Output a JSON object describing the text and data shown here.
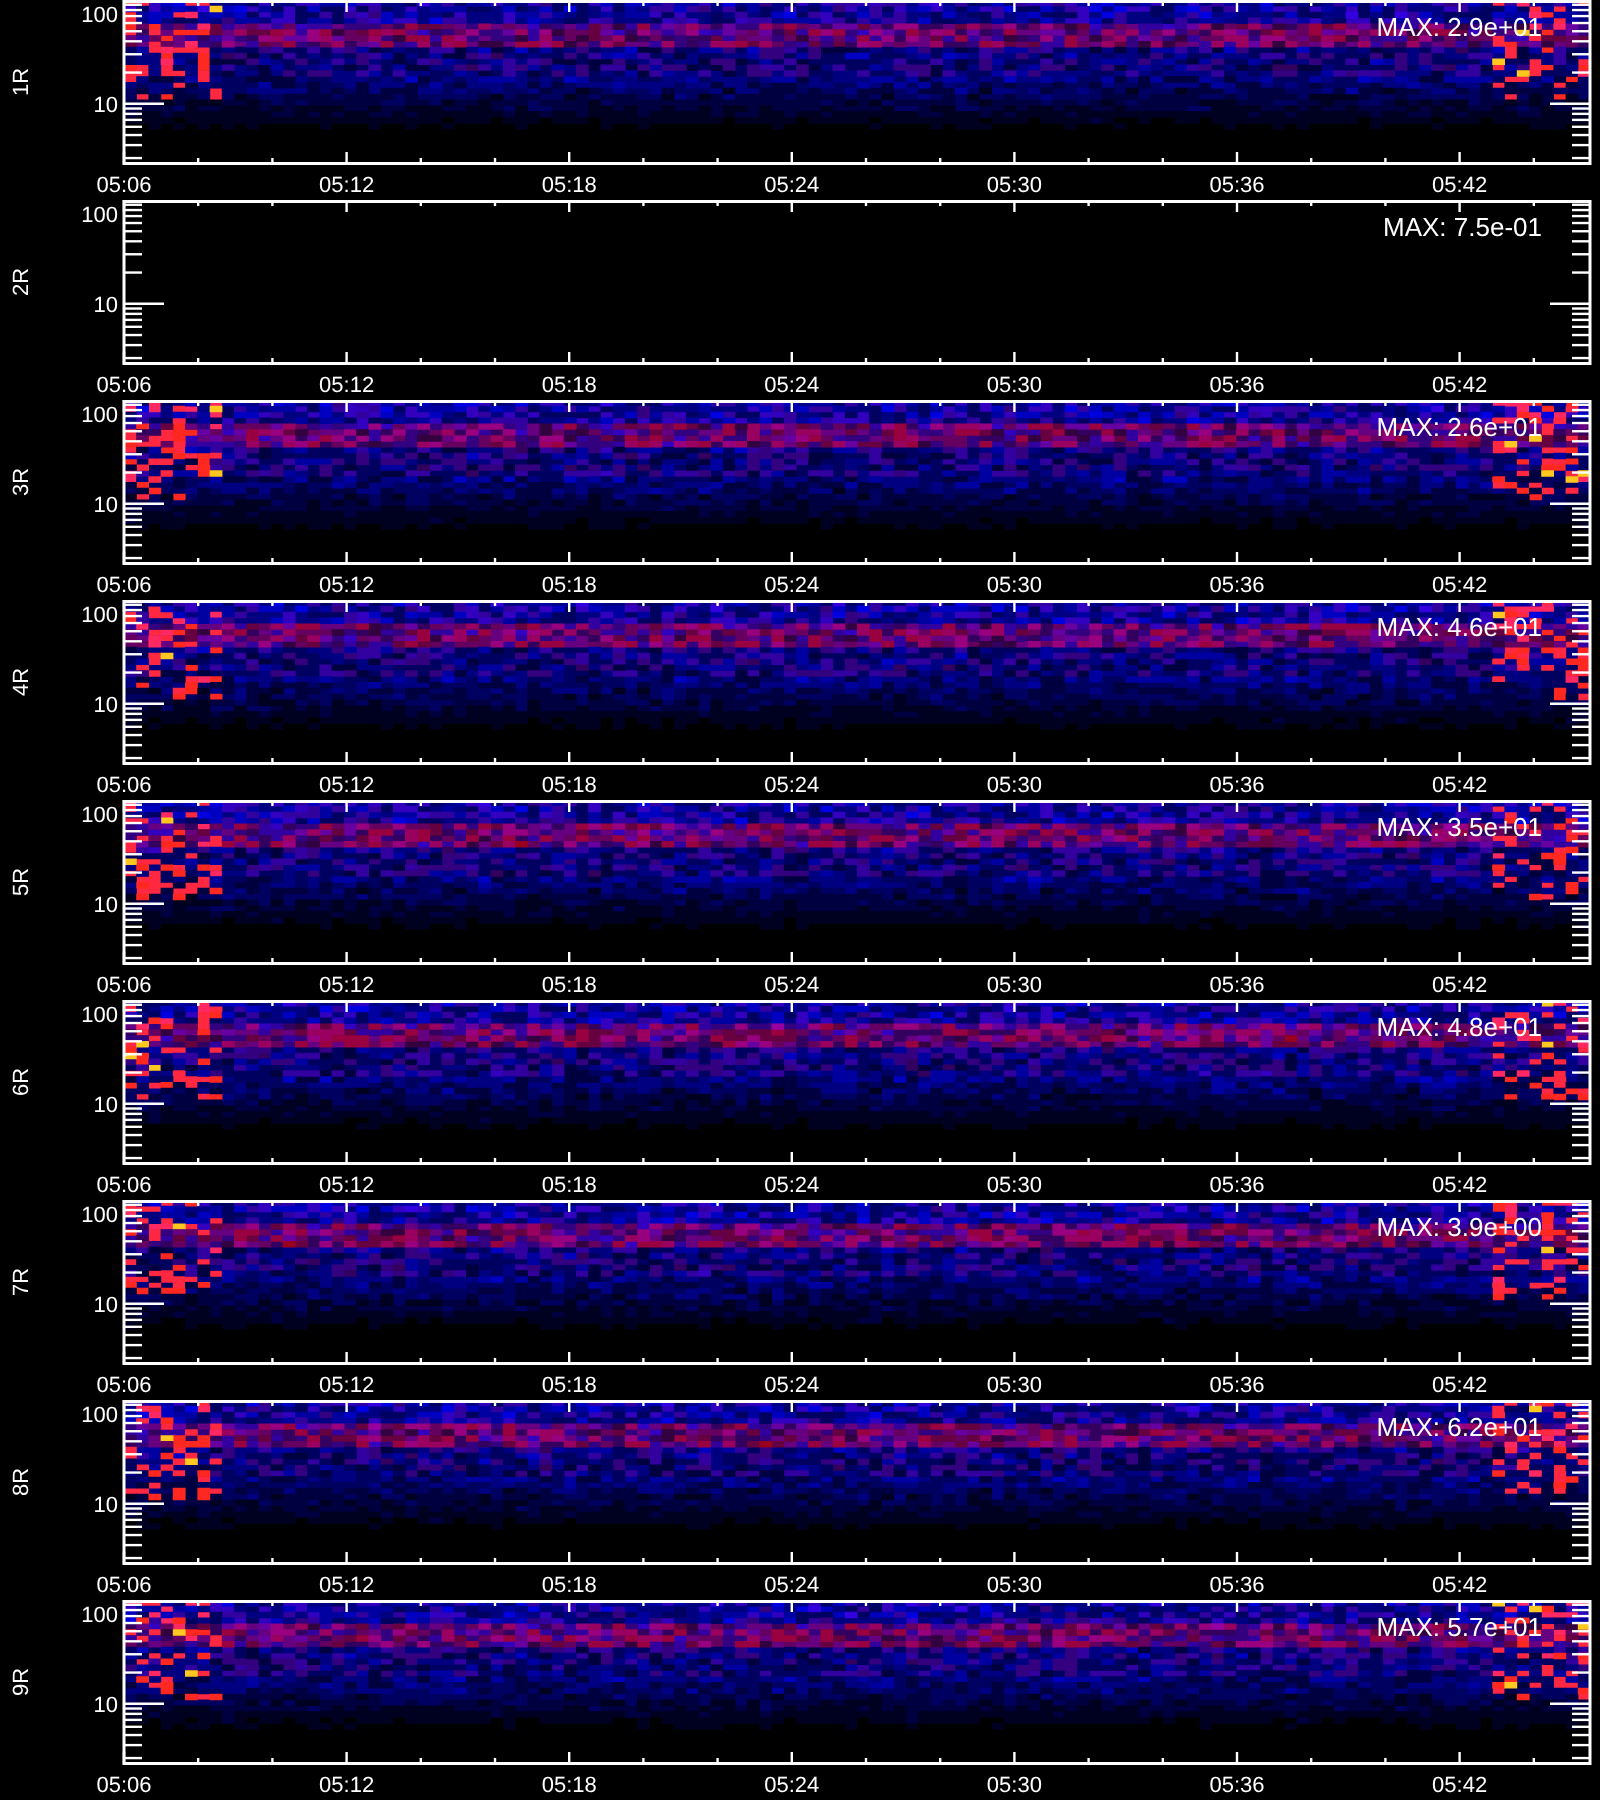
{
  "panels": [
    {
      "label": "1R",
      "max": "MAX: 2.9e+01",
      "blank": false,
      "y_ticks": [
        "100",
        "10"
      ],
      "x_ticks": [
        "05:06",
        "05:12",
        "05:18",
        "05:24",
        "05:30",
        "05:36",
        "05:42"
      ]
    },
    {
      "label": "2R",
      "max": "MAX: 7.5e-01",
      "blank": true,
      "y_ticks": [
        "100",
        "10"
      ],
      "x_ticks": [
        "05:06",
        "05:12",
        "05:18",
        "05:24",
        "05:30",
        "05:36",
        "05:42"
      ]
    },
    {
      "label": "3R",
      "max": "MAX: 2.6e+01",
      "blank": false,
      "y_ticks": [
        "100",
        "10"
      ],
      "x_ticks": [
        "05:06",
        "05:12",
        "05:18",
        "05:24",
        "05:30",
        "05:36",
        "05:42"
      ]
    },
    {
      "label": "4R",
      "max": "MAX: 4.6e+01",
      "blank": false,
      "y_ticks": [
        "100",
        "10"
      ],
      "x_ticks": [
        "05:06",
        "05:12",
        "05:18",
        "05:24",
        "05:30",
        "05:36",
        "05:42"
      ]
    },
    {
      "label": "5R",
      "max": "MAX: 3.5e+01",
      "blank": false,
      "y_ticks": [
        "100",
        "10"
      ],
      "x_ticks": [
        "05:06",
        "05:12",
        "05:18",
        "05:24",
        "05:30",
        "05:36",
        "05:42"
      ]
    },
    {
      "label": "6R",
      "max": "MAX: 4.8e+01",
      "blank": false,
      "y_ticks": [
        "100",
        "10"
      ],
      "x_ticks": [
        "05:06",
        "05:12",
        "05:18",
        "05:24",
        "05:30",
        "05:36",
        "05:42"
      ]
    },
    {
      "label": "7R",
      "max": "MAX: 3.9e+00",
      "blank": false,
      "y_ticks": [
        "100",
        "10"
      ],
      "x_ticks": [
        "05:06",
        "05:12",
        "05:18",
        "05:24",
        "05:30",
        "05:36",
        "05:42"
      ]
    },
    {
      "label": "8R",
      "max": "MAX: 6.2e+01",
      "blank": false,
      "y_ticks": [
        "100",
        "10"
      ],
      "x_ticks": [
        "05:06",
        "05:12",
        "05:18",
        "05:24",
        "05:30",
        "05:36",
        "05:42"
      ]
    },
    {
      "label": "9R",
      "max": "MAX: 5.7e+01",
      "blank": false,
      "y_ticks": [
        "100",
        "10"
      ],
      "x_ticks": [
        "05:06",
        "05:12",
        "05:18",
        "05:24",
        "05:30",
        "05:36",
        "05:42"
      ]
    }
  ]
}
